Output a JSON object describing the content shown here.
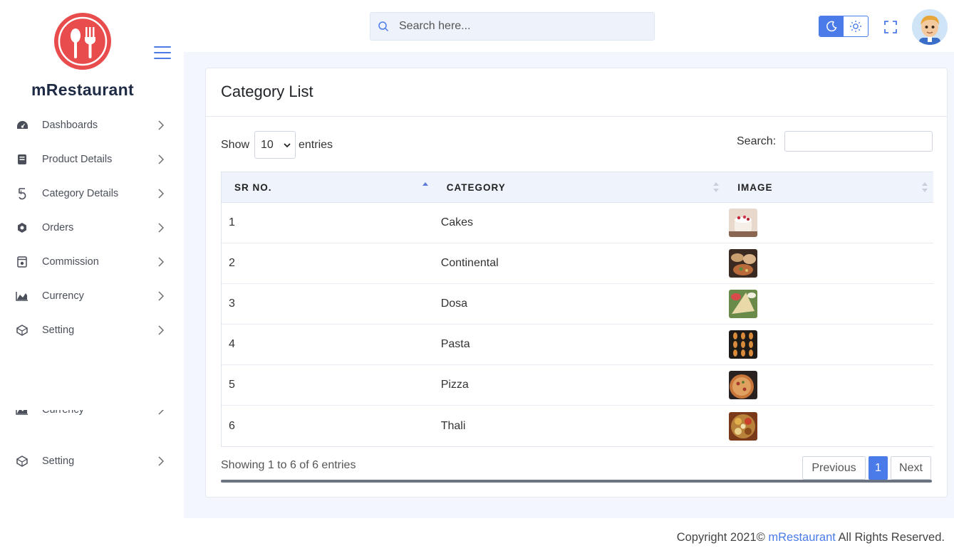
{
  "brand": {
    "name": "mRestaurant",
    "logo_icon": "restaurant-logo-icon",
    "color": "#e84c4c"
  },
  "header": {
    "search_placeholder": "Search here...",
    "accent": "#4a7be8"
  },
  "sidebar": {
    "items": [
      {
        "label": "Dashboards",
        "icon": "dashboard-icon"
      },
      {
        "label": "Product Details",
        "icon": "product-icon"
      },
      {
        "label": "Category Details",
        "icon": "category-icon"
      },
      {
        "label": "Orders",
        "icon": "orders-icon"
      },
      {
        "label": "Commission",
        "icon": "commission-icon"
      },
      {
        "label": "Currency",
        "icon": "currency-icon"
      },
      {
        "label": "Setting",
        "icon": "setting-icon"
      }
    ],
    "duplicate_items": [
      {
        "label": "Currency"
      },
      {
        "label": "Setting"
      }
    ]
  },
  "card": {
    "title": "Category List",
    "show_label": "Show",
    "entries_select": "10",
    "entries_label": "entries",
    "search_label": "Search:",
    "columns": [
      "SR NO.",
      "CATEGORY",
      "IMAGE"
    ],
    "rows": [
      {
        "sr": "1",
        "category": "Cakes"
      },
      {
        "sr": "2",
        "category": "Continental"
      },
      {
        "sr": "3",
        "category": "Dosa"
      },
      {
        "sr": "4",
        "category": "Pasta"
      },
      {
        "sr": "5",
        "category": "Pizza"
      },
      {
        "sr": "6",
        "category": "Thali"
      }
    ],
    "showing_text": "Showing 1 to 6 of 6 entries",
    "pager": {
      "prev": "Previous",
      "current": "1",
      "next": "Next"
    }
  },
  "footer": {
    "prefix": "Copyright 2021© ",
    "link": "mRestaurant",
    "suffix": " All Rights Reserved."
  }
}
